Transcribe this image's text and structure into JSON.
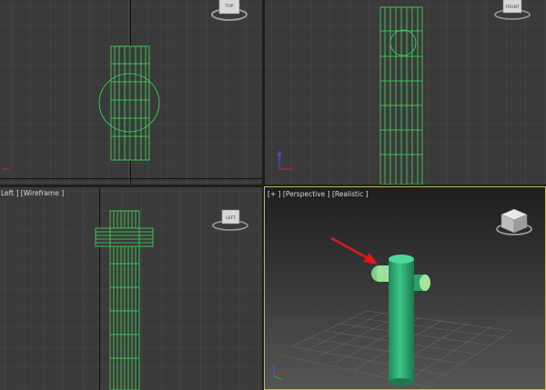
{
  "viewports": {
    "top": {
      "label": ""
    },
    "front": {
      "label": ""
    },
    "left": {
      "label": "Left ] [Wireframe ]"
    },
    "perspective": {
      "label": "[+ ] [Perspective ] [Realistic ]"
    }
  },
  "viewcube": {
    "top_face": "TOP",
    "front_face": "FRONT",
    "left_face": "LEFT"
  },
  "colors": {
    "viewport_bg": "#3a3a3a",
    "grid": "#4a4a4a",
    "wireframe": "#3fe05a",
    "active_border": "#c8b464",
    "annotation_arrow": "#e01818"
  }
}
